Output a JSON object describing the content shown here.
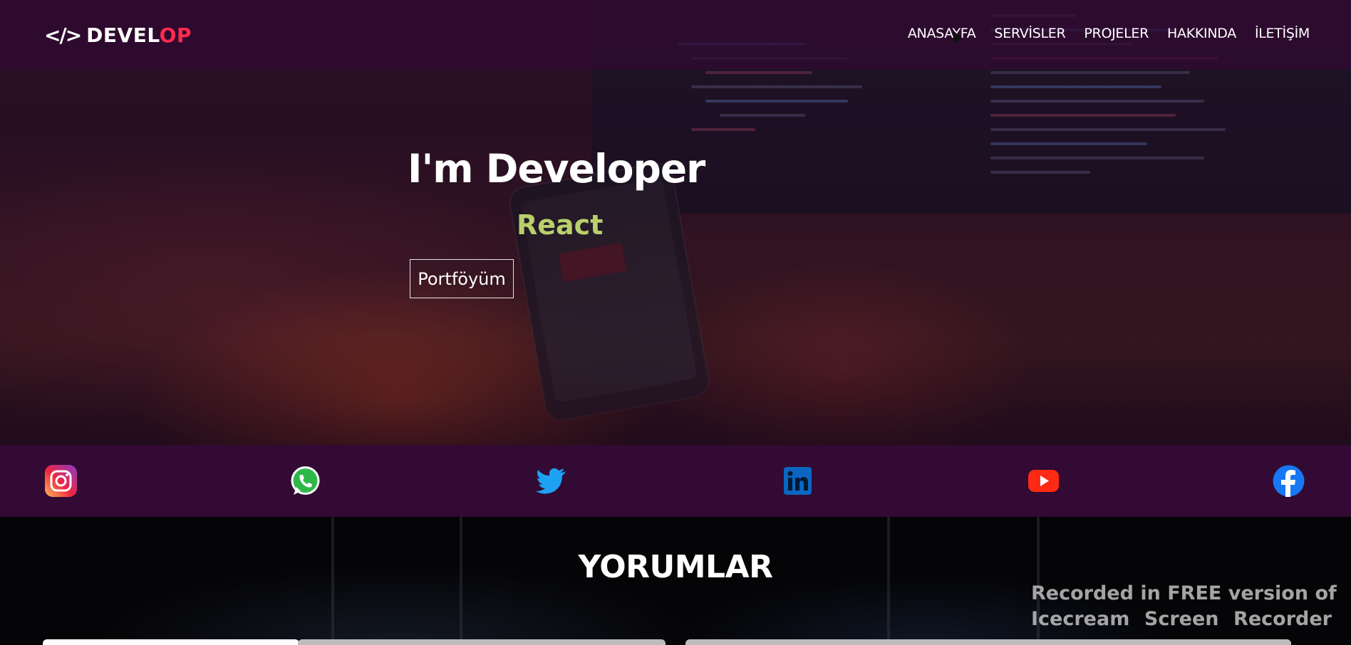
{
  "header": {
    "logo": {
      "icon": "</>",
      "text_a": "DEVEL",
      "text_b": "OP"
    },
    "nav": [
      "ANASAYFA",
      "SERVİSLER",
      "PROJELER",
      "HAKKINDA",
      "İLETİŞİM"
    ]
  },
  "hero": {
    "title": "I'm Developer",
    "subtitle": "React",
    "button_label": "Portföyüm"
  },
  "social": {
    "items": [
      "instagram-icon",
      "whatsapp-icon",
      "twitter-icon",
      "linkedin-icon",
      "youtube-icon",
      "facebook-icon"
    ]
  },
  "reviews": {
    "title": "YORUMLAR"
  },
  "watermark": {
    "line1": "Recorded in FREE version of",
    "line2_words": [
      "Icecream",
      "Screen",
      "Recorder"
    ]
  },
  "colors": {
    "header_bg": "#300832",
    "logo_accent": "#ff2b4f",
    "subtitle": "#b8d06a",
    "social_bar_bg": "#340a36"
  }
}
